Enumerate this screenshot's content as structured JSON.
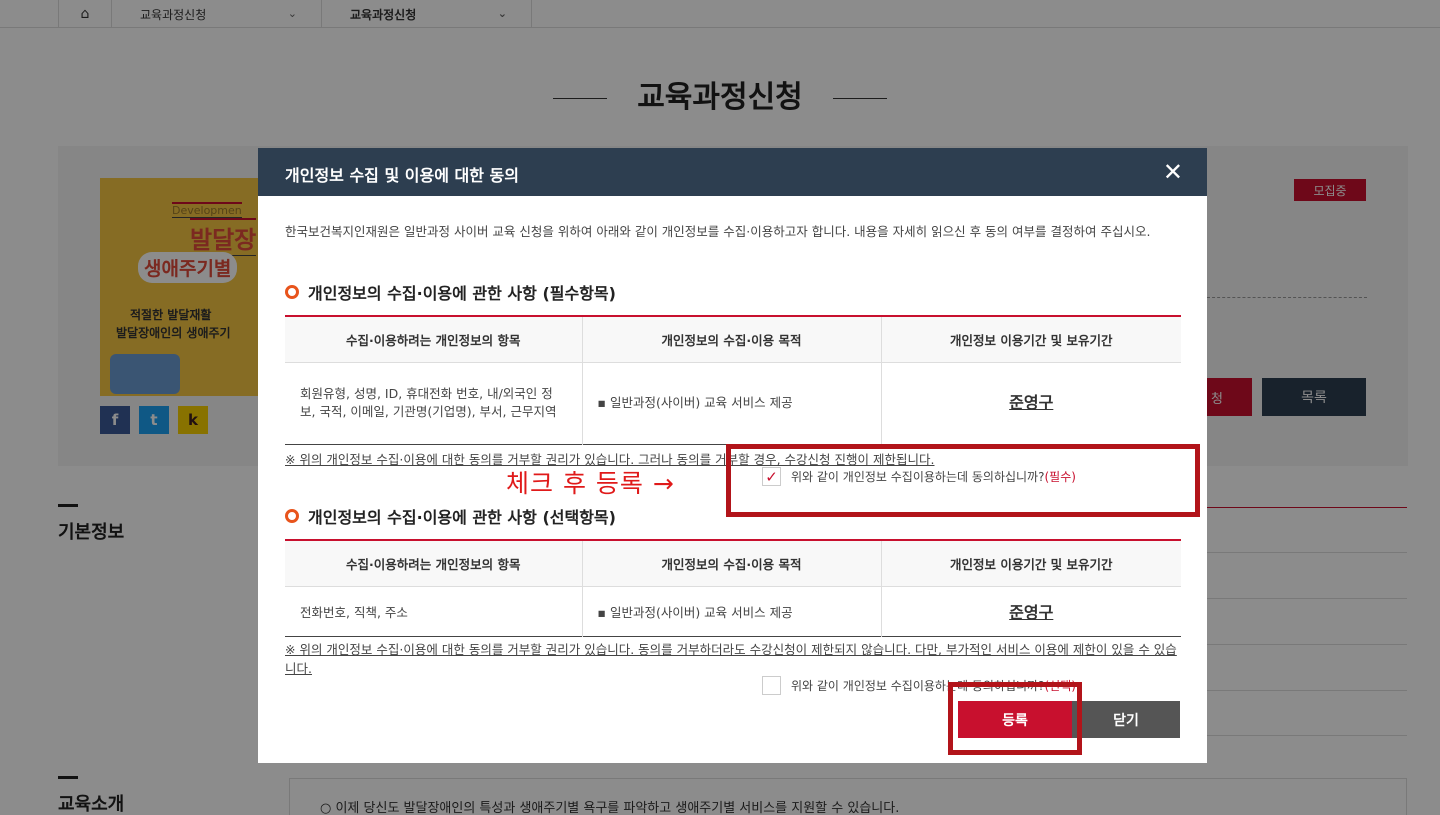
{
  "topnav": {
    "home_icon": "home-icon",
    "crumbs": [
      {
        "label": "교육과정신청"
      },
      {
        "label": "교육과정신청"
      }
    ]
  },
  "page": {
    "title": "교육과정신청"
  },
  "course": {
    "thumb_texts": [
      "Developmen",
      "발달장",
      "생애주기별",
      "적절한 발달재활",
      "발달장애인의 생애주기"
    ],
    "status_badge": "모집중",
    "apply_label": "청",
    "list_label": "목록",
    "sns": [
      "f",
      "t",
      "k"
    ]
  },
  "sections": {
    "basic_info": "기본정보",
    "edu_intro": "교육소개",
    "intro_text": "○ 이제 당신도 발달장애인의 특성과 생애주기별 욕구를 파악하고 생애주기별 서비스를 지원할 수 있습니다."
  },
  "modal": {
    "title": "개인정보 수집 및 이용에 대한 동의",
    "close_icon": "close-icon",
    "intro": "한국보건복지인재원은 일반과정 사이버 교육 신청을 위하여 아래와 같이 개인정보를 수집·이용하고자 합니다. 내용을 자세히 읽으신 후 동의 여부를 결정하여 주십시오.",
    "required": {
      "heading": "개인정보의 수집·이용에 관한 사항 (필수항목)",
      "headers": [
        "수집·이용하려는 개인정보의 항목",
        "개인정보의 수집·이용 목적",
        "개인정보 이용기간 및 보유기간"
      ],
      "row": [
        "회원유형, 성명, ID, 휴대전화 번호, 내/외국인 정보, 국적, 이메일, 기관명(기업명), 부서, 근무지역",
        "▪ 일반과정(사이버) 교육 서비스 제공",
        "준영구"
      ],
      "notice": "※ 위의 개인정보 수집·이용에 대한 동의를 거부할 권리가 있습니다. 그러나 동의를 거부할 경우, 수강신청 진행이 제한됩니다.",
      "agree_label": "위와 같이 개인정보 수집이용하는데 동의하십니까?",
      "agree_tag": "(필수)",
      "checked": true
    },
    "optional": {
      "heading": "개인정보의 수집·이용에 관한 사항 (선택항목)",
      "headers": [
        "수집·이용하려는 개인정보의 항목",
        "개인정보의 수집·이용 목적",
        "개인정보 이용기간 및 보유기간"
      ],
      "row": [
        "전화번호, 직책, 주소",
        "▪ 일반과정(사이버) 교육 서비스 제공",
        "준영구"
      ],
      "notice": "※ 위의 개인정보 수집·이용에 대한 동의를 거부할 권리가 있습니다. 동의를 거부하더라도 수강신청이 제한되지 않습니다. 다만, 부가적인 서비스 이용에 제한이 있을 수 있습니다.",
      "agree_label": "위와 같이 개인정보 수집이용하는데 동의하십니까?",
      "agree_tag": "(선택)",
      "checked": false
    },
    "register_label": "등록",
    "close_label": "닫기"
  },
  "annotation": {
    "text": "체크 후 등록 →"
  },
  "colors": {
    "header_bg": "#2d3e50",
    "accent_red": "#c8102e",
    "ring_orange": "#e8541c",
    "annotation_red": "#b2141a"
  }
}
